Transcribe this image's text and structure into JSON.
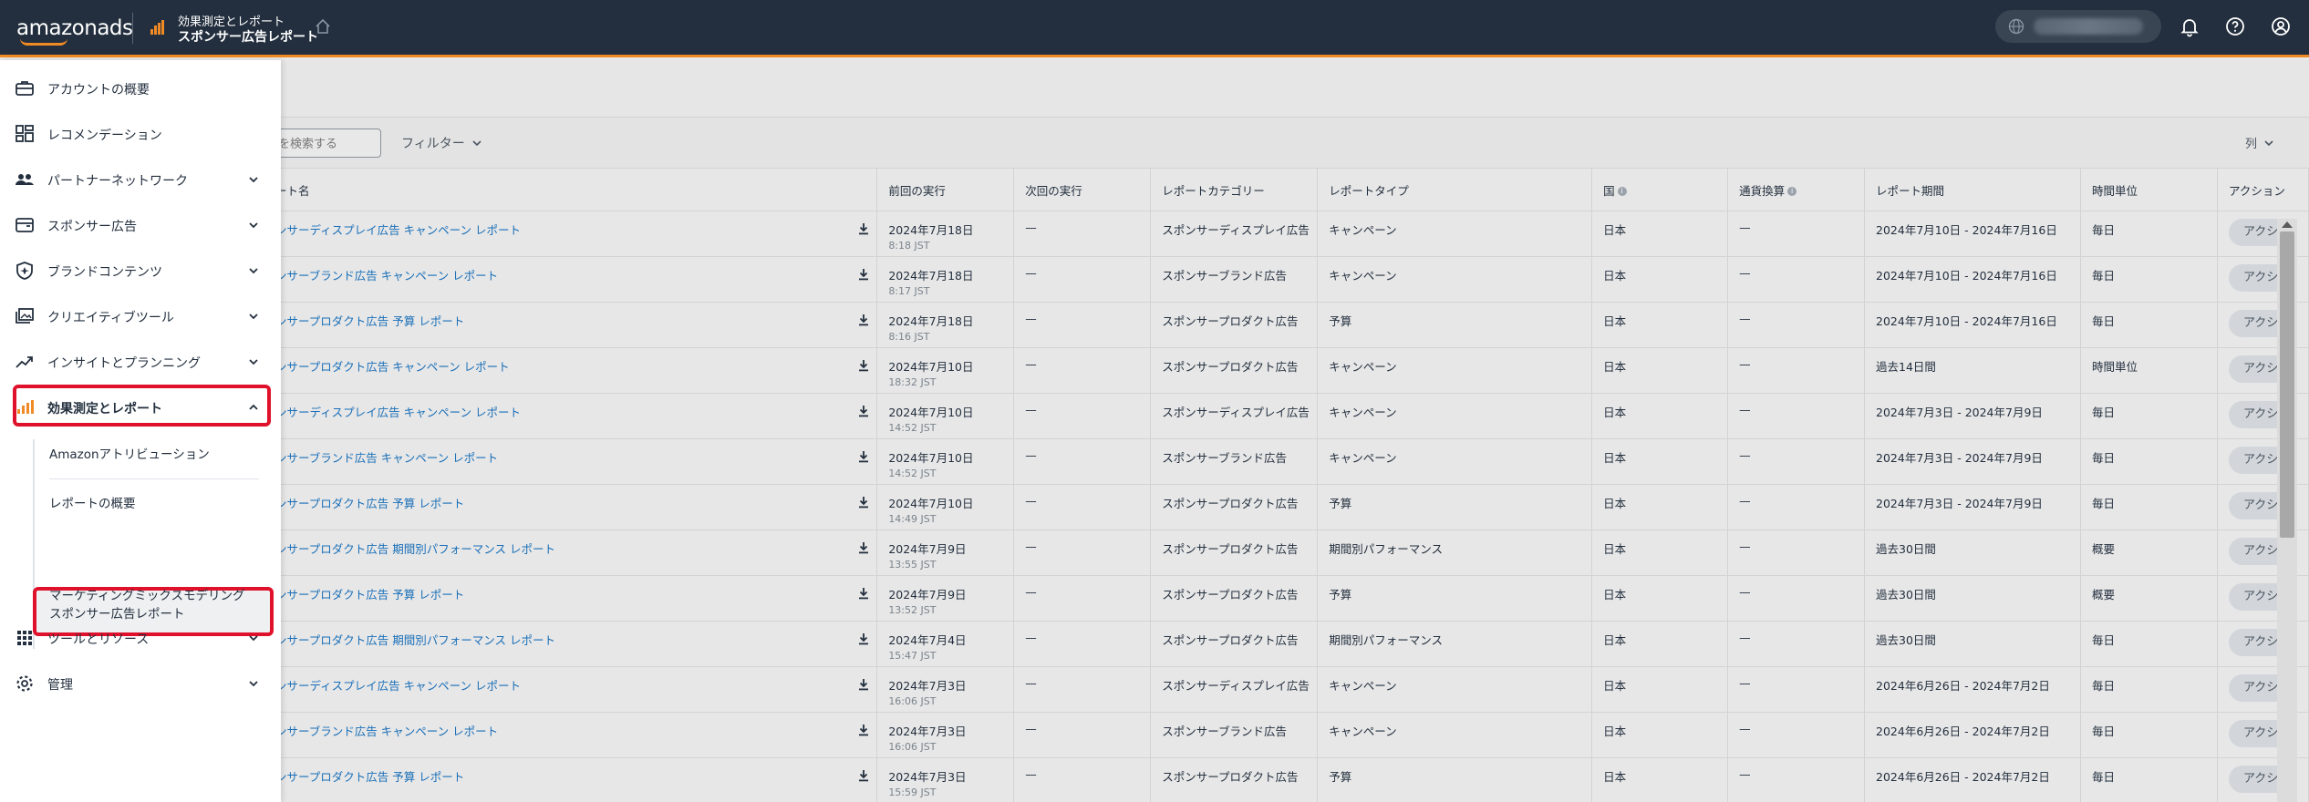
{
  "header": {
    "logo_text": "amazonads",
    "section_small": "効果測定とレポート",
    "section_big": "スポンサー広告レポート"
  },
  "sidebar": {
    "items": [
      {
        "label": "アカウントの概要",
        "icon": "briefcase-icon",
        "has_chevron": false
      },
      {
        "label": "レコメンデーション",
        "icon": "grid-icon",
        "has_chevron": false
      },
      {
        "label": "パートナーネットワーク",
        "icon": "people-icon",
        "has_chevron": true
      },
      {
        "label": "スポンサー広告",
        "icon": "wallet-icon",
        "has_chevron": true
      },
      {
        "label": "ブランドコンテンツ",
        "icon": "shield-icon",
        "has_chevron": true
      },
      {
        "label": "クリエイティブツール",
        "icon": "image-stack-icon",
        "has_chevron": true
      },
      {
        "label": "インサイトとプランニング",
        "icon": "trend-icon",
        "has_chevron": true
      },
      {
        "label": "効果測定とレポート",
        "icon": "bar-chart-icon",
        "has_chevron": true,
        "expanded": true
      },
      {
        "label": "ツールとリソース",
        "icon": "dots-grid-icon",
        "has_chevron": true
      },
      {
        "label": "管理",
        "icon": "gear-icon",
        "has_chevron": true
      }
    ],
    "sub_items": [
      {
        "label": "Amazonアトリビューション"
      },
      {
        "label": "レポートの概要"
      },
      {
        "label": "スポンサー広告レポート",
        "selected": true
      },
      {
        "label": "マーケティングミックスモデリング"
      }
    ]
  },
  "toolbar": {
    "search_placeholder": "を検索する",
    "filter_label": "フィルター",
    "columns_label": "列"
  },
  "table": {
    "headers": [
      "ート名",
      "前回の実行",
      "次回の実行",
      "レポートカテゴリー",
      "レポートタイプ",
      "国",
      "通貨換算",
      "レポート期間",
      "時間単位",
      "アクション"
    ],
    "action_label": "アクシ",
    "rows": [
      {
        "name": "ンサーディスプレイ広告 キャンペーン レポート",
        "last_run": "2024年7月18日",
        "last_run_time": "8:18 JST",
        "next_run": "—",
        "category": "スポンサーディスプレイ広告",
        "type": "キャンペーン",
        "country": "日本",
        "currency": "—",
        "period": "2024年7月10日 - 2024年7月16日",
        "unit": "毎日"
      },
      {
        "name": "ンサーブランド広告 キャンペーン レポート",
        "last_run": "2024年7月18日",
        "last_run_time": "8:17 JST",
        "next_run": "—",
        "category": "スポンサーブランド広告",
        "type": "キャンペーン",
        "country": "日本",
        "currency": "—",
        "period": "2024年7月10日 - 2024年7月16日",
        "unit": "毎日"
      },
      {
        "name": "ンサープロダクト広告 予算 レポート",
        "last_run": "2024年7月18日",
        "last_run_time": "8:16 JST",
        "next_run": "—",
        "category": "スポンサープロダクト広告",
        "type": "予算",
        "country": "日本",
        "currency": "—",
        "period": "2024年7月10日 - 2024年7月16日",
        "unit": "毎日"
      },
      {
        "name": "ンサープロダクト広告 キャンペーン レポート",
        "last_run": "2024年7月10日",
        "last_run_time": "18:32 JST",
        "next_run": "—",
        "category": "スポンサープロダクト広告",
        "type": "キャンペーン",
        "country": "日本",
        "currency": "—",
        "period": "過去14日間",
        "unit": "時間単位"
      },
      {
        "name": "ンサーディスプレイ広告 キャンペーン レポート",
        "last_run": "2024年7月10日",
        "last_run_time": "14:52 JST",
        "next_run": "—",
        "category": "スポンサーディスプレイ広告",
        "type": "キャンペーン",
        "country": "日本",
        "currency": "—",
        "period": "2024年7月3日 - 2024年7月9日",
        "unit": "毎日"
      },
      {
        "name": "ンサーブランド広告 キャンペーン レポート",
        "last_run": "2024年7月10日",
        "last_run_time": "14:52 JST",
        "next_run": "—",
        "category": "スポンサーブランド広告",
        "type": "キャンペーン",
        "country": "日本",
        "currency": "—",
        "period": "2024年7月3日 - 2024年7月9日",
        "unit": "毎日"
      },
      {
        "name": "ンサープロダクト広告 予算 レポート",
        "last_run": "2024年7月10日",
        "last_run_time": "14:49 JST",
        "next_run": "—",
        "category": "スポンサープロダクト広告",
        "type": "予算",
        "country": "日本",
        "currency": "—",
        "period": "2024年7月3日 - 2024年7月9日",
        "unit": "毎日"
      },
      {
        "name": "ンサープロダクト広告 期間別パフォーマンス レポート",
        "last_run": "2024年7月9日",
        "last_run_time": "13:55 JST",
        "next_run": "—",
        "category": "スポンサープロダクト広告",
        "type": "期間別パフォーマンス",
        "country": "日本",
        "currency": "—",
        "period": "過去30日間",
        "unit": "概要"
      },
      {
        "name": "ンサープロダクト広告 予算 レポート",
        "last_run": "2024年7月9日",
        "last_run_time": "13:52 JST",
        "next_run": "—",
        "category": "スポンサープロダクト広告",
        "type": "予算",
        "country": "日本",
        "currency": "—",
        "period": "過去30日間",
        "unit": "概要"
      },
      {
        "name": "ンサープロダクト広告 期間別パフォーマンス レポート",
        "last_run": "2024年7月4日",
        "last_run_time": "15:47 JST",
        "next_run": "—",
        "category": "スポンサープロダクト広告",
        "type": "期間別パフォーマンス",
        "country": "日本",
        "currency": "—",
        "period": "過去30日間",
        "unit": "毎日"
      },
      {
        "name": "ンサーディスプレイ広告 キャンペーン レポート",
        "last_run": "2024年7月3日",
        "last_run_time": "16:06 JST",
        "next_run": "—",
        "category": "スポンサーディスプレイ広告",
        "type": "キャンペーン",
        "country": "日本",
        "currency": "—",
        "period": "2024年6月26日 - 2024年7月2日",
        "unit": "毎日"
      },
      {
        "name": "ンサーブランド広告 キャンペーン レポート",
        "last_run": "2024年7月3日",
        "last_run_time": "16:06 JST",
        "next_run": "—",
        "category": "スポンサーブランド広告",
        "type": "キャンペーン",
        "country": "日本",
        "currency": "—",
        "period": "2024年6月26日 - 2024年7月2日",
        "unit": "毎日"
      },
      {
        "name": "ンサープロダクト広告 予算 レポート",
        "last_run": "2024年7月3日",
        "last_run_time": "15:59 JST",
        "next_run": "—",
        "category": "スポンサープロダクト広告",
        "type": "予算",
        "country": "日本",
        "currency": "—",
        "period": "2024年6月26日 - 2024年7月2日",
        "unit": "毎日"
      }
    ]
  },
  "colors": {
    "header_bg": "#232f3e",
    "accent_orange": "#f08a24",
    "highlight_red": "#e0112b",
    "link_blue": "#1a6fb8"
  }
}
